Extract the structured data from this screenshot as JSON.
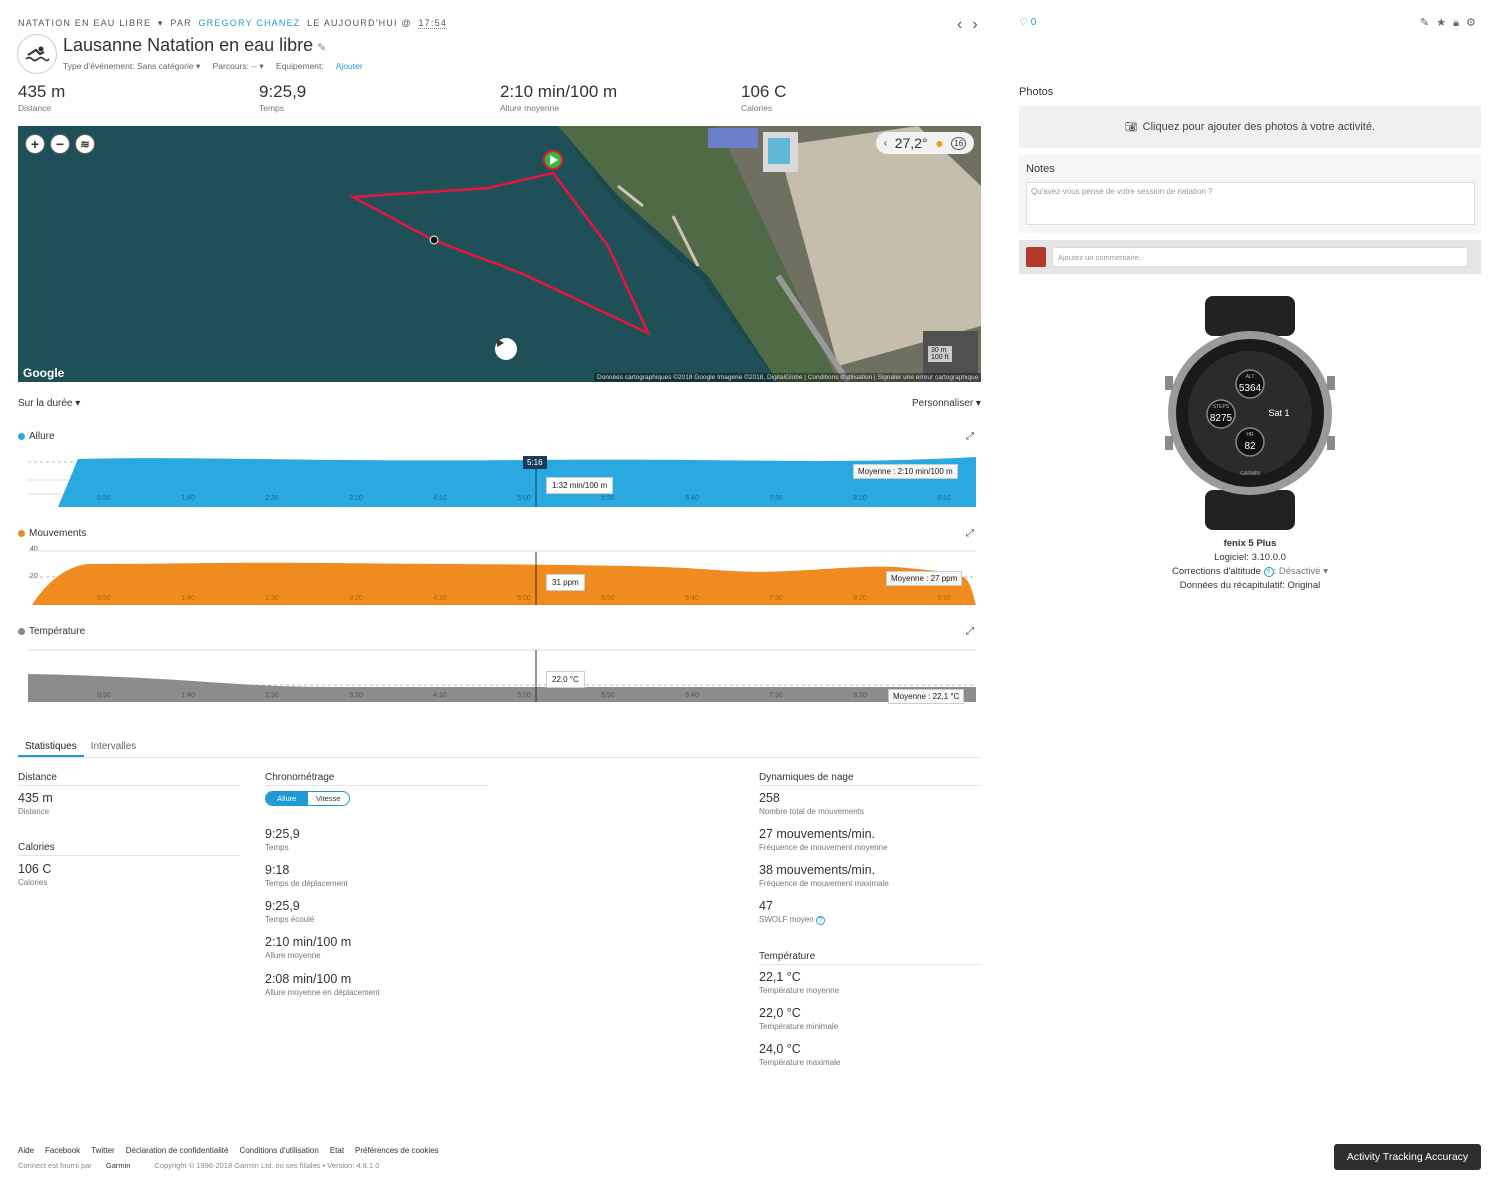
{
  "header": {
    "breadcrumb_type": "NATATION EN EAU LIBRE",
    "breadcrumb_arrow": "▾",
    "by": "PAR",
    "author": "GREGORY CHANEZ",
    "when": "LE AUJOURD'HUI @",
    "time": "17:54",
    "likes": "0"
  },
  "activity": {
    "title": "Lausanne Natation en eau libre",
    "event_type": "Type d'événement: Sans catégorie ▾",
    "course": "Parcours: -- ▾",
    "equipment_label": "Equipement:",
    "equipment_link": "Ajouter"
  },
  "summary": [
    {
      "value": "435 m",
      "label": "Distance"
    },
    {
      "value": "9:25,9",
      "label": "Temps"
    },
    {
      "value": "2:10 min/100 m",
      "label": "Allure moyenne"
    },
    {
      "value": "106 C",
      "label": "Calories"
    }
  ],
  "map": {
    "temperature": "27,2°",
    "time_badge": "16",
    "google": "Google",
    "copyright": "Données cartographiques ©2018 Google Imagerie ©2018, DigitalGlobe | Conditions d'utilisation | Signaler une erreur cartographique",
    "scale_m": "30 m",
    "scale_ft": "100 ft"
  },
  "controls": {
    "range": "Sur la durée ▾",
    "customize": "Personnaliser ▾"
  },
  "x_ticks": [
    "0:50",
    "1:40",
    "2:30",
    "3:20",
    "4:10",
    "5:00",
    "5:50",
    "6:40",
    "7:30",
    "8:20",
    "9:10"
  ],
  "charts": {
    "pace": {
      "label": "Allure",
      "color": "#29a9e0",
      "cursor": "5:16",
      "tooltip": "1:32 min/100 m",
      "average": "Moyenne : 2:10 min/100 m"
    },
    "strokes": {
      "label": "Mouvements",
      "color": "#f08c1f",
      "tick_40": "40",
      "tick_20": "20",
      "tooltip": "31 ppm",
      "average": "Moyenne : 27 ppm"
    },
    "temp": {
      "label": "Température",
      "color": "#888888",
      "tooltip": "22,0 °C",
      "average": "Moyenne : 22,1 °C"
    }
  },
  "tabs": {
    "stats": "Statistiques",
    "intervals": "Intervalles"
  },
  "stats": {
    "distance_h": "Distance",
    "distance": {
      "value": "435 m",
      "label": "Distance"
    },
    "calories_h": "Calories",
    "calories": {
      "value": "106 C",
      "label": "Calories"
    },
    "timing_h": "Chronométrage",
    "toggle_pace": "Allure",
    "toggle_speed": "Vitesse",
    "timing": [
      {
        "value": "9:25,9",
        "label": "Temps"
      },
      {
        "value": "9:18",
        "label": "Temps de déplacement"
      },
      {
        "value": "9:25,9",
        "label": "Temps écoulé"
      },
      {
        "value": "2:10 min/100 m",
        "label": "Allure moyenne"
      },
      {
        "value": "2:08 min/100 m",
        "label": "Allure moyenne en déplacement"
      }
    ],
    "swim_h": "Dynamiques de nage",
    "swim": [
      {
        "value": "258",
        "label": "Nombre total de mouvements"
      },
      {
        "value": "27 mouvements/min.",
        "label": "Fréquence de mouvement moyenne"
      },
      {
        "value": "38 mouvements/min.",
        "label": "Fréquence de mouvement maximale"
      },
      {
        "value": "47",
        "label": "SWOLF moyen"
      }
    ],
    "temp_h": "Température",
    "temps": [
      {
        "value": "22,1 °C",
        "label": "Température moyenne"
      },
      {
        "value": "22,0 °C",
        "label": "Température minimale"
      },
      {
        "value": "24,0 °C",
        "label": "Température maximale"
      }
    ]
  },
  "sidebar": {
    "photos_h": "Photos",
    "photos_cta": "Cliquez pour ajouter des photos à votre activité.",
    "notes_h": "Notes",
    "notes_placeholder": "Qu'avez-vous pensé de votre session de natation ?",
    "comment_placeholder": "Ajoutez un commentaire."
  },
  "device": {
    "name": "fenix 5 Plus",
    "software": "Logiciel: 3.10.0.0",
    "altitude_corr_label": "Corrections d'altitude",
    "altitude_corr_value": "Désactivé ▾",
    "summary_data": "Données du récapitulatif: Original",
    "face_alt_label": "ALT",
    "face_alt": "5364",
    "face_steps_label": "STEPS",
    "face_steps": "8275",
    "face_hr_label": "HR",
    "face_hr": "82",
    "face_date": "Sat 1",
    "face_brand": "GARMIN"
  },
  "footer": {
    "links": [
      "Aide",
      "Facebook",
      "Twitter",
      "Déclaration de confidentialité",
      "Conditions d'utilisation",
      "Etat",
      "Préférences de cookies"
    ],
    "powered": "Connect est fourni par",
    "garmin": "Garmin",
    "copyright": "Copyright © 1996-2018 Garmin Ltd. ou ses filiales • Version: 4.8.1.0",
    "ata_button": "Activity Tracking Accuracy"
  }
}
